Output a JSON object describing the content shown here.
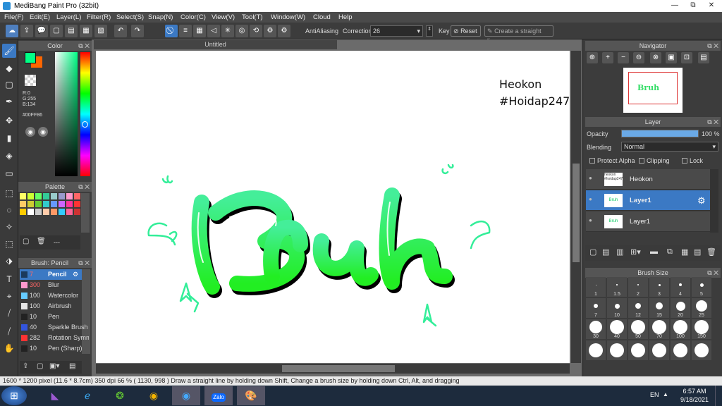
{
  "window": {
    "title": "MediBang Paint Pro (32bit)",
    "min": "—",
    "max": "⧉",
    "close": "✕"
  },
  "menu": [
    "File(F)",
    "Edit(E)",
    "Layer(L)",
    "Filter(R)",
    "Select(S)",
    "Snap(N)",
    "Color(C)",
    "View(V)",
    "Tool(T)",
    "Window(W)",
    "Cloud",
    "Help"
  ],
  "toolbar": {
    "antialiasing": "AntiAliasing",
    "correction_label": "Correction",
    "correction_value": "26",
    "key_label": "Key",
    "reset_label": "Reset",
    "straight_line_label": "Create a straight line"
  },
  "color_panel": {
    "title": "Color",
    "r": "R:0",
    "g": "G:255",
    "b": "B:134",
    "hex": "#00FF86",
    "fg": "#00FF86",
    "bg": "#FF6600"
  },
  "palette_panel": {
    "title": "Palette",
    "swatches": [
      "#ffff66",
      "#ccff33",
      "#66ff66",
      "#33cc99",
      "#99cccc",
      "#9999cc",
      "#ff99cc",
      "#ff6666",
      "#ffcc66",
      "#cccc33",
      "#66cc33",
      "#33cccc",
      "#6699ff",
      "#cc66ff",
      "#ff3399",
      "#ff3333",
      "#ffcc00",
      "#ffffff",
      "#cccccc",
      "#ffccaa",
      "#ff9966",
      "#33ccff",
      "#ff6699",
      "#cc3333"
    ],
    "dash": "---"
  },
  "brush_panel": {
    "title": "Brush: Pencil",
    "items": [
      {
        "color": "#1b3a5c",
        "size": "7",
        "label": "Pencil"
      },
      {
        "color": "#ff99cc",
        "size": "300",
        "label": "Blur"
      },
      {
        "color": "#66ccff",
        "size": "100",
        "label": "Watercolor"
      },
      {
        "color": "#e6e6e6",
        "size": "100",
        "label": "Airbrush"
      },
      {
        "color": "#222222",
        "size": "10",
        "label": "Pen"
      },
      {
        "color": "#3355dd",
        "size": "40",
        "label": "Sparkle Brush"
      },
      {
        "color": "#ff3333",
        "size": "282",
        "label": "Rotation Symmetry"
      },
      {
        "color": "#222222",
        "size": "10",
        "label": "Pen (Sharp)"
      }
    ]
  },
  "canvas": {
    "tab": "Untitled",
    "signature_line1": "Heokon",
    "signature_line2": "#Hoidap247",
    "lettering": "Bruh"
  },
  "navigator": {
    "title": "Navigator"
  },
  "layer_panel": {
    "title": "Layer",
    "opacity_label": "Opacity",
    "opacity_value": "100 %",
    "opacity_fraction": 1.0,
    "blending_label": "Blending",
    "blending_value": "Normal",
    "protect_alpha": "Protect Alpha",
    "clipping": "Clipping",
    "lock": "Lock",
    "layers": [
      {
        "name": "Heokon",
        "thumb": "heokon #hoidap247"
      },
      {
        "name": "Layer1",
        "thumb": "Bruh"
      },
      {
        "name": "Layer1",
        "thumb": "Bruh"
      }
    ]
  },
  "brush_size": {
    "title": "Brush Size",
    "sizes": [
      "1",
      "1.5",
      "2",
      "3",
      "4",
      "5",
      "7",
      "10",
      "12",
      "15",
      "20",
      "25",
      "30",
      "40",
      "50",
      "70",
      "100",
      "150",
      "",
      "",
      "",
      "",
      "",
      ""
    ]
  },
  "status": {
    "text": "1600 * 1200 pixel   (11.6 * 8.7cm)   350 dpi   66 %   ( 1130, 998 )   Draw a straight line by holding down Shift, Change a brush size by holding down Ctrl, Alt, and dragging"
  },
  "taskbar": {
    "lang": "EN",
    "time": "6:57 AM",
    "date": "9/18/2021",
    "zalo": "Zalo"
  }
}
